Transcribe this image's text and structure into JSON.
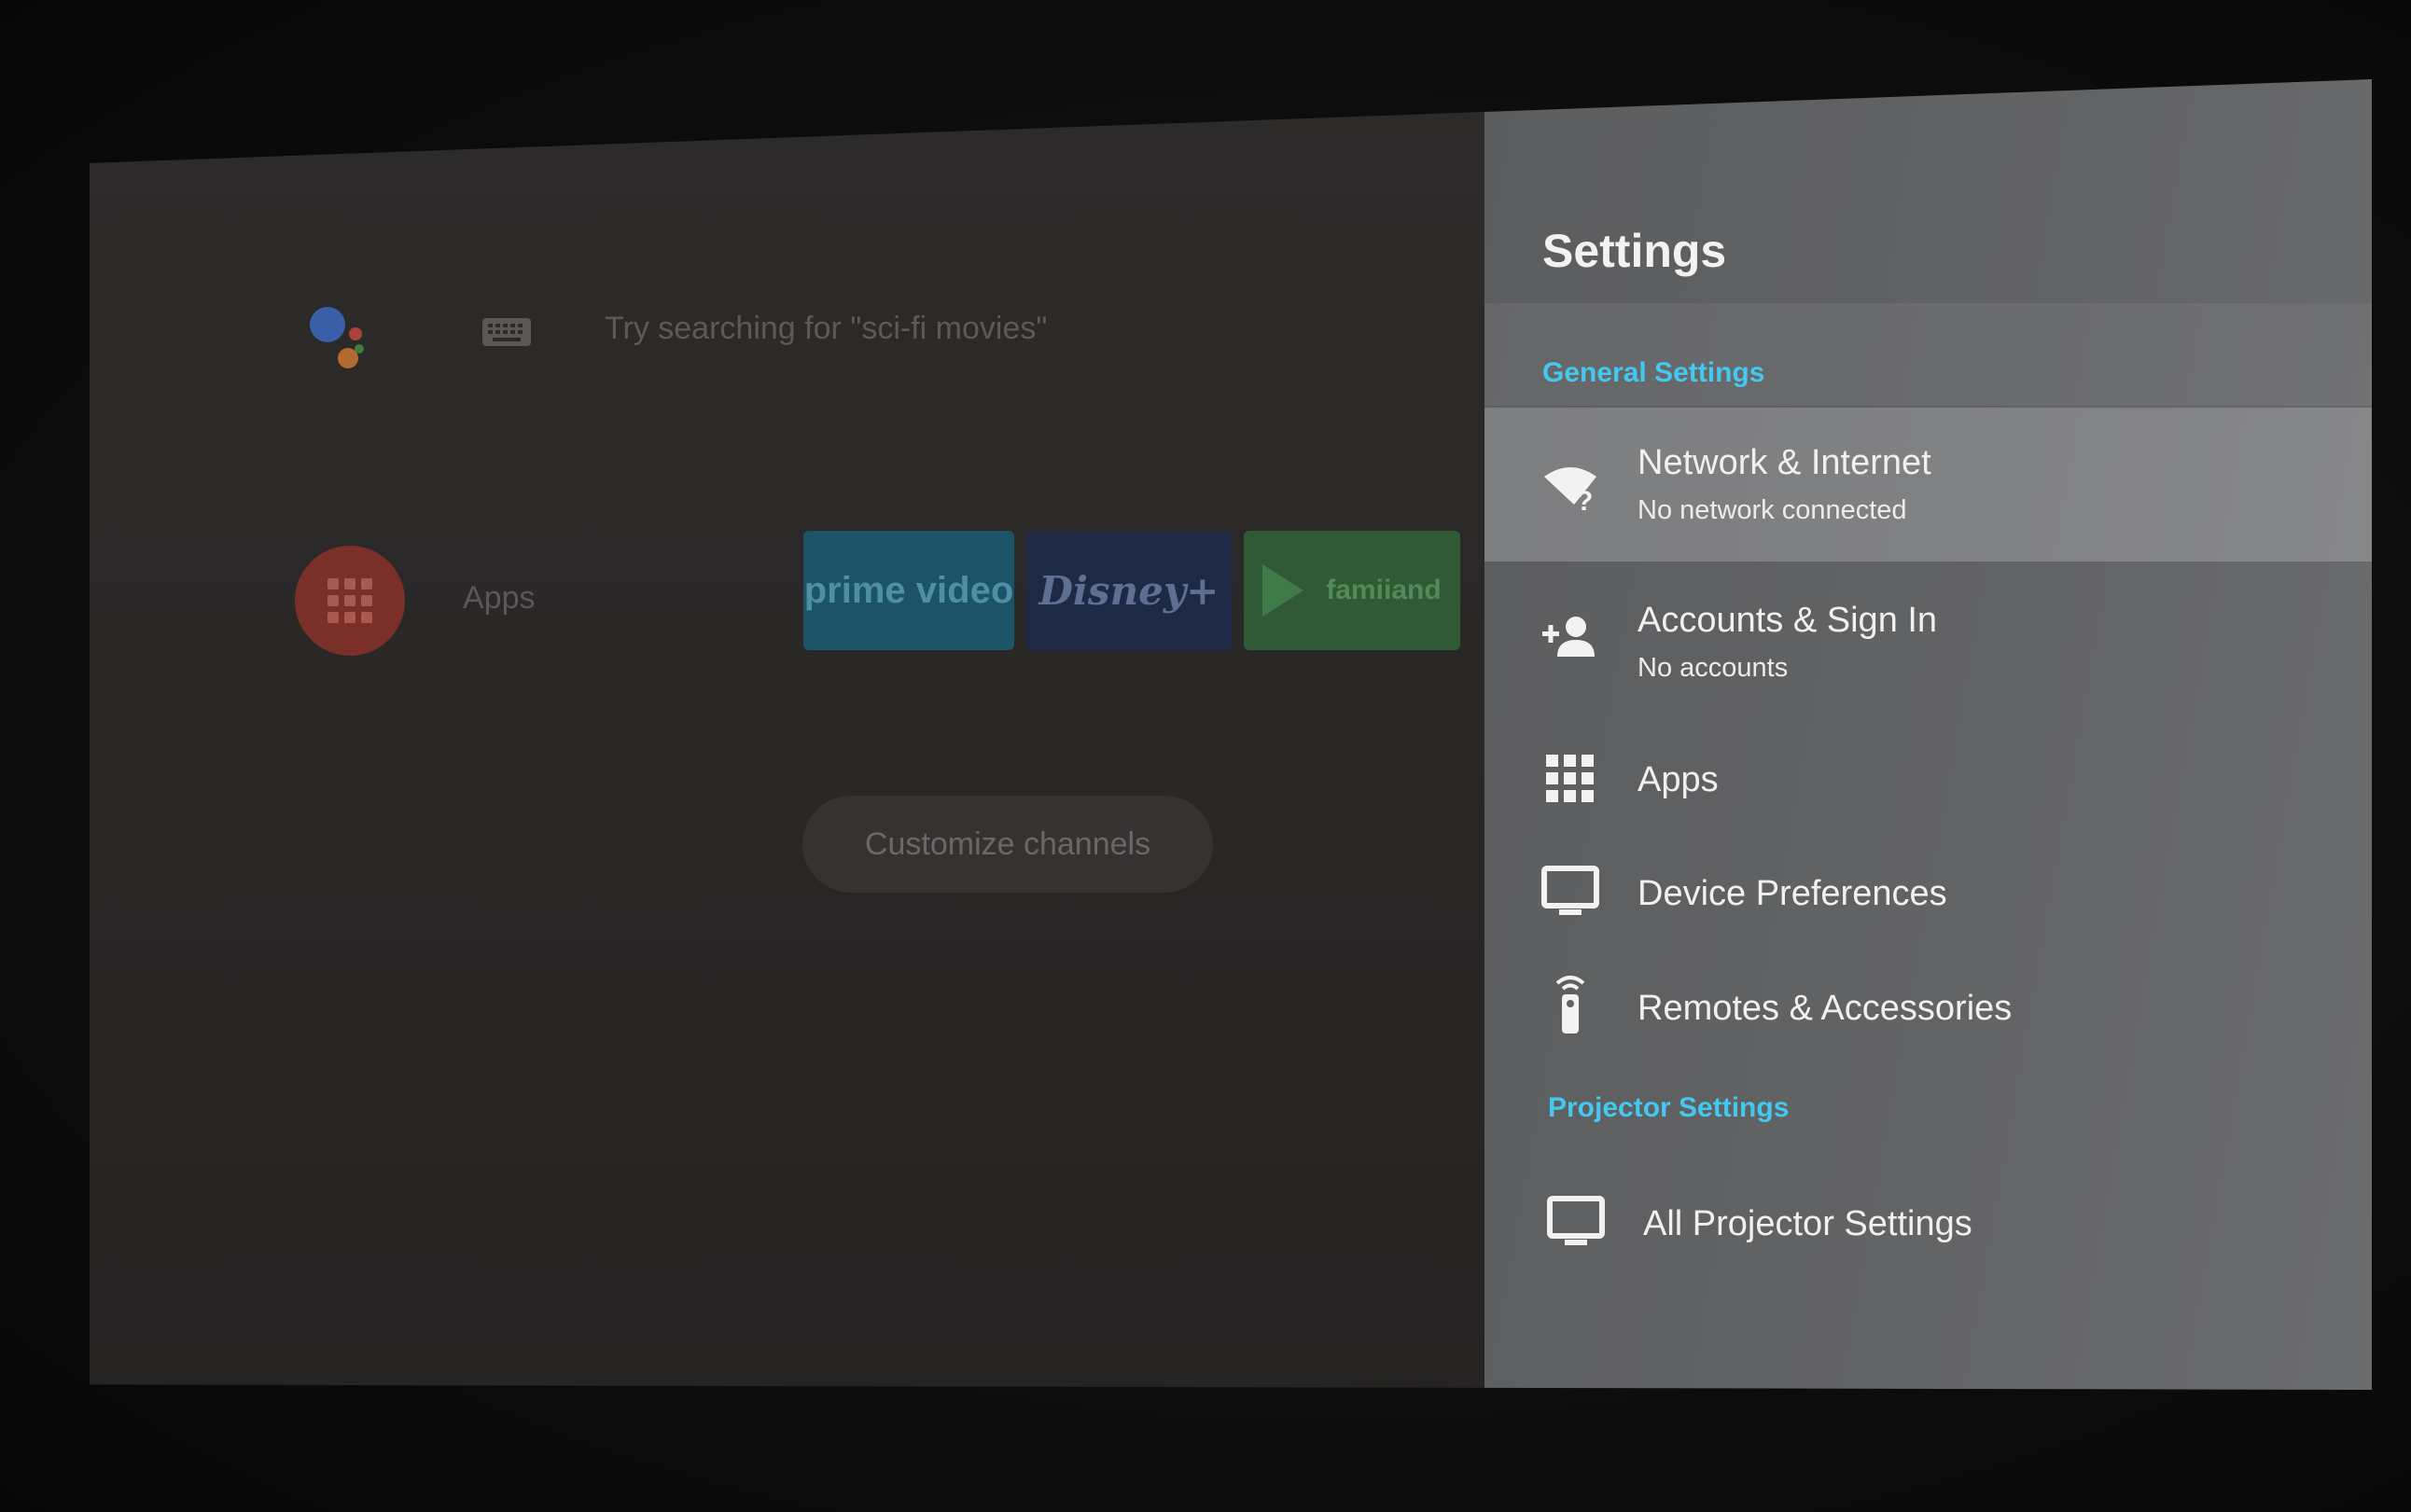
{
  "home": {
    "search_hint": "Try searching for \"sci-fi movies\"",
    "apps_label": "Apps",
    "channels": [
      {
        "name": "prime video"
      },
      {
        "name": "Disney+"
      },
      {
        "name": "famiiand"
      }
    ],
    "customize_label": "Customize channels"
  },
  "settings": {
    "title": "Settings",
    "general_header": "General Settings",
    "items": [
      {
        "icon": "wifi-question-icon",
        "title": "Network & Internet",
        "subtitle": "No network connected",
        "focused": true
      },
      {
        "icon": "add-person-icon",
        "title": "Accounts & Sign In",
        "subtitle": "No accounts"
      },
      {
        "icon": "apps-grid-icon",
        "title": "Apps"
      },
      {
        "icon": "monitor-icon",
        "title": "Device Preferences"
      },
      {
        "icon": "remote-icon",
        "title": "Remotes & Accessories"
      }
    ],
    "projector_header": "Projector Settings",
    "projector_items": [
      {
        "icon": "monitor-icon",
        "title": "All Projector Settings"
      }
    ]
  },
  "colors": {
    "accent": "#43c8ef",
    "panel_bg": "#616264",
    "home_bg": "#2a2827"
  }
}
